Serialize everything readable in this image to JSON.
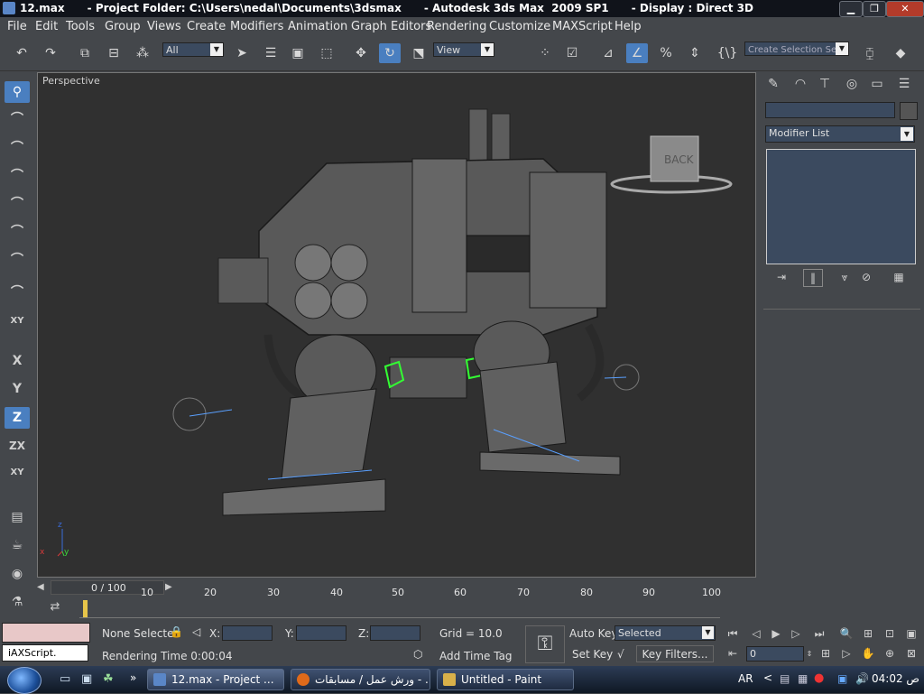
{
  "window": {
    "title": "12.max      - Project Folder: C:\\Users\\nedal\\Documents\\3dsmax      - Autodesk 3ds Max  2009 SP1      - Display : Direct 3D",
    "minimize": "▁",
    "maximize": "❐",
    "close": "✕"
  },
  "menu": [
    "File",
    "Edit",
    "Tools",
    "Group",
    "Views",
    "Create",
    "Modifiers",
    "Animation",
    "Graph Editors",
    "Rendering",
    "Customize",
    "MAXScript",
    "Help"
  ],
  "toolbar": {
    "selection_filter": "All",
    "ref_coord": "View",
    "named_selection_placeholder": "Create Selection Set",
    "curly_label": "{\\}"
  },
  "left_tools": {
    "x": "X",
    "y": "Y",
    "z": "Z",
    "zx": "ZX",
    "xy": "XY"
  },
  "viewport": {
    "label": "Perspective",
    "viewcube_label": "BACK",
    "axis_x": "x",
    "axis_y": "y",
    "axis_z": "z"
  },
  "command_panel": {
    "name_field": "",
    "modifier_list": "Modifier List"
  },
  "timeline": {
    "frame_display": "0 / 100",
    "ticks": [
      "10",
      "20",
      "30",
      "40",
      "50",
      "60",
      "70",
      "80",
      "90",
      "100"
    ]
  },
  "status": {
    "selection_info": "None Selecte",
    "maxscript_prompt": "",
    "maxscript_label": "iAXScript.",
    "rendering_time": "Rendering Time  0:00:04",
    "x_label": "X:",
    "y_label": "Y:",
    "z_label": "Z:",
    "grid": "Grid = 10.0",
    "add_time_tag": "Add Time Tag",
    "auto_key": "Auto Key",
    "set_key": "Set Key",
    "key_mode": "Selected",
    "key_filters": "Key Filters...",
    "current_frame": "0"
  },
  "taskbar": {
    "tasks": [
      "12.max     - Project ...",
      "ورش عمل / مسابقات - ...",
      "Untitled - Paint"
    ],
    "language": "AR",
    "clock": "04:02 ص"
  },
  "colors": {
    "accent": "#4a7fc0",
    "viewport_bg": "#303030",
    "ui_bg": "#44474b",
    "field_bg": "#3b4a5f"
  }
}
